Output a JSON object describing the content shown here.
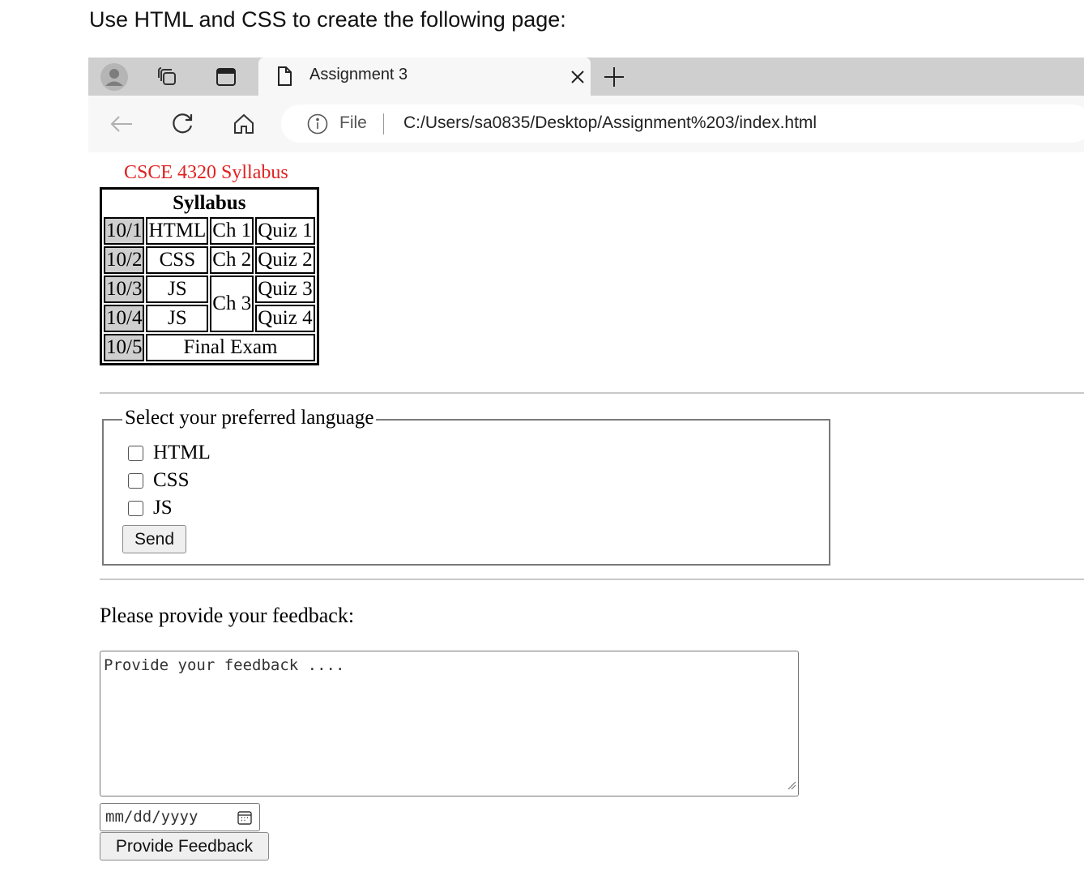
{
  "instruction": "Use HTML and CSS to create the following page:",
  "browser": {
    "tab_title": "Assignment 3",
    "address": {
      "scheme_label": "File",
      "url": "C:/Users/sa0835/Desktop/Assignment%203/index.html"
    },
    "icons": [
      "profile-icon",
      "workspaces-icon",
      "tab-actions-icon",
      "page-icon",
      "close-icon",
      "new-tab-icon",
      "back-icon",
      "refresh-icon",
      "home-icon",
      "info-icon"
    ]
  },
  "page": {
    "heading": "CSCE 4320 Syllabus",
    "heading_color": "#e22020",
    "table": {
      "caption": "Syllabus",
      "rows": [
        {
          "date": "10/1",
          "topic": "HTML",
          "chapter": "Ch 1",
          "quiz": "Quiz 1"
        },
        {
          "date": "10/2",
          "topic": "CSS",
          "chapter": "Ch 2",
          "quiz": "Quiz 2"
        },
        {
          "date": "10/3",
          "topic": "JS",
          "chapter": "Ch 3",
          "quiz": "Quiz 3"
        },
        {
          "date": "10/4",
          "topic": "JS",
          "quiz": "Quiz 4"
        },
        {
          "date": "10/5",
          "topic": "Final Exam"
        }
      ]
    },
    "language_form": {
      "legend": "Select your preferred language",
      "options": [
        "HTML",
        "CSS",
        "JS"
      ],
      "submit_label": "Send"
    },
    "feedback": {
      "label": "Please provide your feedback:",
      "textarea_placeholder": "Provide your feedback ....",
      "date_placeholder": "mm/dd/yyyy",
      "submit_label": "Provide Feedback"
    }
  }
}
